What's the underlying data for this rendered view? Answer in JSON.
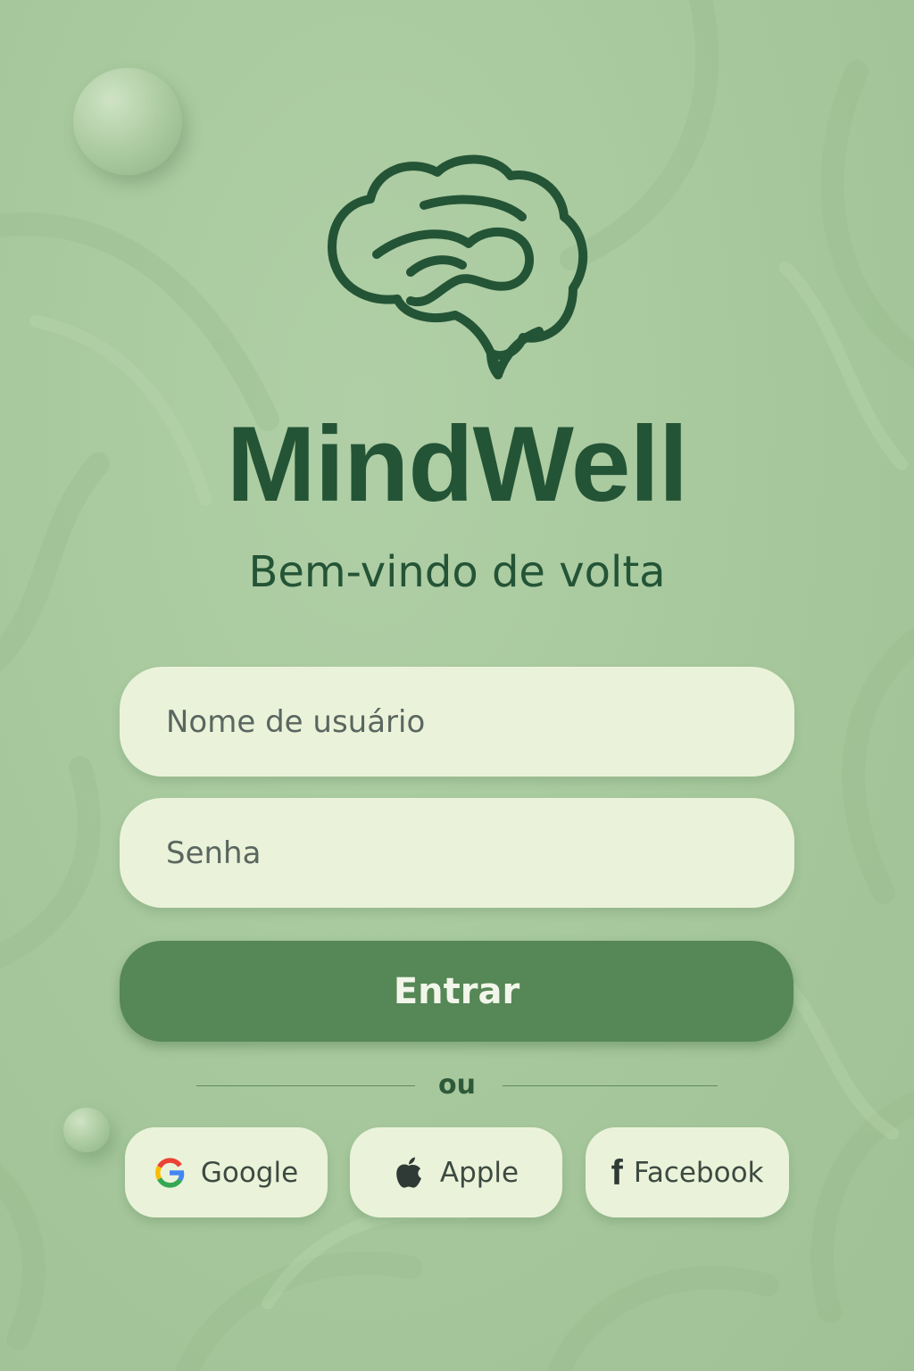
{
  "app": {
    "name": "MindWell",
    "tagline": "Bem-vindo de volta"
  },
  "login_form": {
    "username": {
      "value": "",
      "placeholder": "Nome de usuário"
    },
    "password": {
      "value": "",
      "placeholder": "Senha"
    },
    "submit_label": "Entrar"
  },
  "divider": {
    "label": "ou"
  },
  "social_login": [
    {
      "label": "Google",
      "icon": "google-icon"
    },
    {
      "label": "Apple",
      "icon": "apple-icon"
    },
    {
      "label": "Facebook",
      "icon": "facebook-icon"
    }
  ],
  "colors": {
    "background": "#a9c9a0",
    "brand_dark": "#245436",
    "primary_button": "#568756",
    "field_background": "#eaf3d9"
  }
}
